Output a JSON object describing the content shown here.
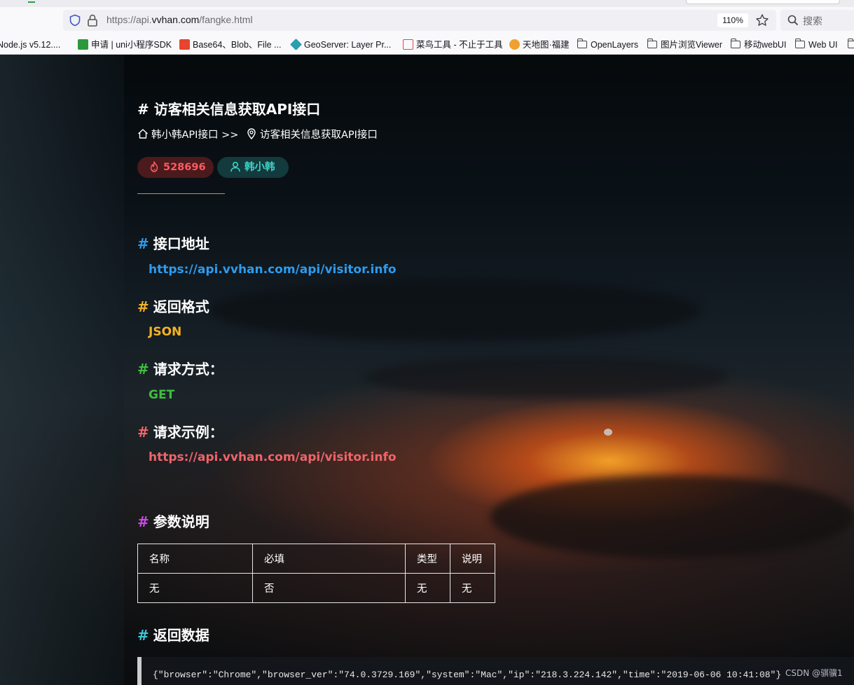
{
  "browser": {
    "url_prefix": "https://api.",
    "url_host": "vvhan.com",
    "url_path": "/fangke.html",
    "zoom": "110%",
    "search_label": "搜索",
    "bookmarks": [
      {
        "label": "Node.js v5.12....",
        "icon": "nodejs-icon"
      },
      {
        "label": "申请 | uni小程序SDK",
        "icon": "uni-icon",
        "color": "#2b9939"
      },
      {
        "label": "Base64、Blob、File ...",
        "icon": "c-icon",
        "color": "#e8442e"
      },
      {
        "label": "GeoServer: Layer Pr...",
        "icon": "geoserver-icon",
        "color": "#2a9fb0"
      },
      {
        "label": "菜鸟工具 - 不止于工具",
        "icon": "cube-icon",
        "color": "#e84545"
      },
      {
        "label": "天地图·福建",
        "icon": "sun-icon",
        "color": "#f0a030"
      },
      {
        "label": "OpenLayers",
        "icon": "folder-icon"
      },
      {
        "label": "图片浏览Viewer",
        "icon": "folder-icon"
      },
      {
        "label": "移动webUI",
        "icon": "folder-icon"
      },
      {
        "label": "Web UI",
        "icon": "folder-icon"
      }
    ]
  },
  "page": {
    "title": "# 访客相关信息获取API接口",
    "breadcrumb_home": "韩小韩API接口",
    "breadcrumb_sep": ">>",
    "breadcrumb_current": "访客相关信息获取API接口",
    "views": "528696",
    "author": "韩小韩",
    "sections": {
      "address": {
        "hash": "#",
        "title": "接口地址",
        "value": "https://api.vvhan.com/api/visitor.info"
      },
      "format": {
        "hash": "#",
        "title": "返回格式",
        "value": "JSON"
      },
      "method": {
        "hash": "#",
        "title": "请求方式：",
        "value": "GET"
      },
      "example": {
        "hash": "#",
        "title": "请求示例：",
        "value": "https://api.vvhan.com/api/visitor.info"
      },
      "params": {
        "hash": "#",
        "title": "参数说明"
      },
      "response": {
        "hash": "#",
        "title": "返回数据"
      }
    },
    "params_table": {
      "headers": [
        "名称",
        "必填",
        "类型",
        "说明"
      ],
      "rows": [
        [
          "无",
          "否",
          "无",
          "无"
        ]
      ]
    },
    "response_code": "{\"browser\":\"Chrome\",\"browser_ver\":\"74.0.3729.169\",\"system\":\"Mac\",\"ip\":\"218.3.224.142\",\"time\":\"2019-06-06 10:41:08\"}",
    "watermark": "CSDN @骐骥1"
  },
  "colors": {
    "address": "#2d9cf0",
    "format": "#f5b324",
    "method": "#3fbf3f",
    "example": "#f0646a",
    "params": "#c84be6",
    "response": "#3fc4d8"
  }
}
